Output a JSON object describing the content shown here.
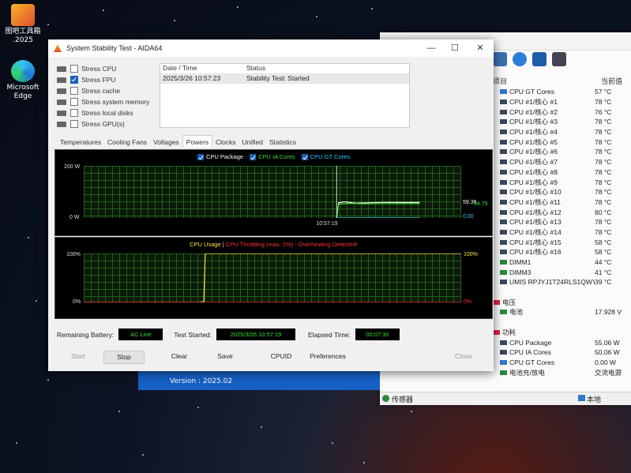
{
  "desktop": {
    "icons": [
      {
        "label_line1": "图吧工具箱",
        "label_line2": ".2025"
      },
      {
        "label_line1": "Microsoft",
        "label_line2": "Edge"
      }
    ]
  },
  "back_window": {
    "columns": {
      "item": "项目",
      "value": "当前值"
    },
    "sensors": [
      {
        "name": "CPU GT Cores",
        "value": "57 °C",
        "icon": "blue"
      },
      {
        "name": "CPU #1/核心 #1",
        "value": "78 °C",
        "icon": "chip"
      },
      {
        "name": "CPU #1/核心 #2",
        "value": "76 °C",
        "icon": "chip"
      },
      {
        "name": "CPU #1/核心 #3",
        "value": "78 °C",
        "icon": "chip"
      },
      {
        "name": "CPU #1/核心 #4",
        "value": "78 °C",
        "icon": "chip"
      },
      {
        "name": "CPU #1/核心 #5",
        "value": "78 °C",
        "icon": "chip"
      },
      {
        "name": "CPU #1/核心 #6",
        "value": "78 °C",
        "icon": "chip"
      },
      {
        "name": "CPU #1/核心 #7",
        "value": "78 °C",
        "icon": "chip"
      },
      {
        "name": "CPU #1/核心 #8",
        "value": "78 °C",
        "icon": "chip"
      },
      {
        "name": "CPU #1/核心 #9",
        "value": "78 °C",
        "icon": "chip"
      },
      {
        "name": "CPU #1/核心 #10",
        "value": "78 °C",
        "icon": "chip"
      },
      {
        "name": "CPU #1/核心 #11",
        "value": "78 °C",
        "icon": "chip"
      },
      {
        "name": "CPU #1/核心 #12",
        "value": "80 °C",
        "icon": "chip"
      },
      {
        "name": "CPU #1/核心 #13",
        "value": "78 °C",
        "icon": "chip"
      },
      {
        "name": "CPU #1/核心 #14",
        "value": "78 °C",
        "icon": "chip"
      },
      {
        "name": "CPU #1/核心 #15",
        "value": "58 °C",
        "icon": "chip"
      },
      {
        "name": "CPU #1/核心 #16",
        "value": "58 °C",
        "icon": "chip"
      },
      {
        "name": "DIMM1",
        "value": "44 °C",
        "icon": "green"
      },
      {
        "name": "DIMM3",
        "value": "41 °C",
        "icon": "green"
      },
      {
        "name": "UMIS RPJYJ1T24RLS1QWY",
        "value": "39 °C",
        "icon": "chip"
      },
      {
        "name": "",
        "value": "",
        "icon": "",
        "spacer": true
      },
      {
        "name": "电压",
        "value": "",
        "icon": "red",
        "group": true
      },
      {
        "name": "电池",
        "value": "17.928 V",
        "icon": "green"
      },
      {
        "name": "",
        "value": "",
        "icon": "",
        "spacer": true
      },
      {
        "name": "功耗",
        "value": "",
        "icon": "red",
        "group": true
      },
      {
        "name": "CPU Package",
        "value": "55.06 W",
        "icon": "chip"
      },
      {
        "name": "CPU IA Cores",
        "value": "50.06 W",
        "icon": "chip"
      },
      {
        "name": "CPU GT Cores",
        "value": "0.00 W",
        "icon": "blue"
      },
      {
        "name": "电池充/放电",
        "value": "交流电源",
        "icon": "green"
      }
    ],
    "status_left": "传感器",
    "status_right": "本地"
  },
  "version_bar": {
    "text": "Version : 2025.02"
  },
  "main_window": {
    "title": "System Stability Test - AIDA64",
    "stress_items": [
      {
        "label": "Stress CPU",
        "checked": false
      },
      {
        "label": "Stress FPU",
        "checked": true
      },
      {
        "label": "Stress cache",
        "checked": false
      },
      {
        "label": "Stress system memory",
        "checked": false
      },
      {
        "label": "Stress local disks",
        "checked": false
      },
      {
        "label": "Stress GPU(s)",
        "checked": false
      }
    ],
    "log": {
      "headers": [
        "Date / Time",
        "Status"
      ],
      "rows": [
        [
          "2025/3/26 10:57:23",
          "Stability Test: Started"
        ]
      ]
    },
    "tabs": [
      "Temperatures",
      "Cooling Fans",
      "Voltages",
      "Powers",
      "Clocks",
      "Unified",
      "Statistics"
    ],
    "active_tab": "Powers",
    "bottom": {
      "remaining_battery_label": "Remaining Battery:",
      "remaining_battery_value": "AC Line",
      "test_started_label": "Test Started:",
      "test_started_value": "2025/3/26 10:57:19",
      "elapsed_label": "Elapsed Time:",
      "elapsed_value": "00:07:30"
    },
    "buttons": {
      "start": "Start",
      "stop": "Stop",
      "clear": "Clear",
      "save": "Save",
      "cpuid": "CPUID",
      "preferences": "Preferences",
      "close": "Close"
    }
  },
  "chart_data": [
    {
      "type": "line",
      "series": [
        {
          "name": "CPU Package",
          "color": "#ffffff",
          "end_label": "59.36",
          "points": [
            [
              0.67,
              0
            ],
            [
              0.675,
              58
            ],
            [
              0.69,
              62
            ],
            [
              0.72,
              57
            ],
            [
              0.8,
              60
            ],
            [
              0.85,
              59.4
            ],
            [
              0.89,
              59.36
            ]
          ]
        },
        {
          "name": "CPU IA Cores",
          "color": "#35e12a",
          "end_label": "54.79",
          "points": [
            [
              0.67,
              0
            ],
            [
              0.675,
              52
            ],
            [
              0.7,
              56
            ],
            [
              0.75,
              54
            ],
            [
              0.8,
              55
            ],
            [
              0.89,
              54.79
            ]
          ]
        },
        {
          "name": "CPU GT Cores",
          "color": "#28c8ff",
          "end_label": "0.00",
          "points": [
            [
              0.67,
              0
            ],
            [
              0.89,
              0
            ]
          ]
        }
      ],
      "y_top_label": "200 W",
      "y_bottom_label": "0 W",
      "ylim": [
        0,
        200
      ],
      "x_marker_label": "10:57:19"
    },
    {
      "type": "line",
      "title_left": "CPU Usage",
      "title_sep": "|",
      "title_right": "CPU Throttling (max: 2%) - Overheating Detected!",
      "series": [
        {
          "name": "CPU Usage",
          "color": "#ffe23a",
          "end_label": "100%",
          "points": [
            [
              0.0,
              0
            ],
            [
              0.305,
              0
            ],
            [
              0.318,
              2
            ],
            [
              0.322,
              100
            ],
            [
              1.0,
              100
            ]
          ]
        },
        {
          "name": "CPU Throttling",
          "color": "#ff3030",
          "end_label": "0%",
          "points": [
            [
              0.0,
              0
            ],
            [
              1.0,
              0
            ]
          ]
        }
      ],
      "y_top_label": "100%",
      "y_bottom_label": "0%",
      "ylim": [
        0,
        100
      ]
    }
  ]
}
